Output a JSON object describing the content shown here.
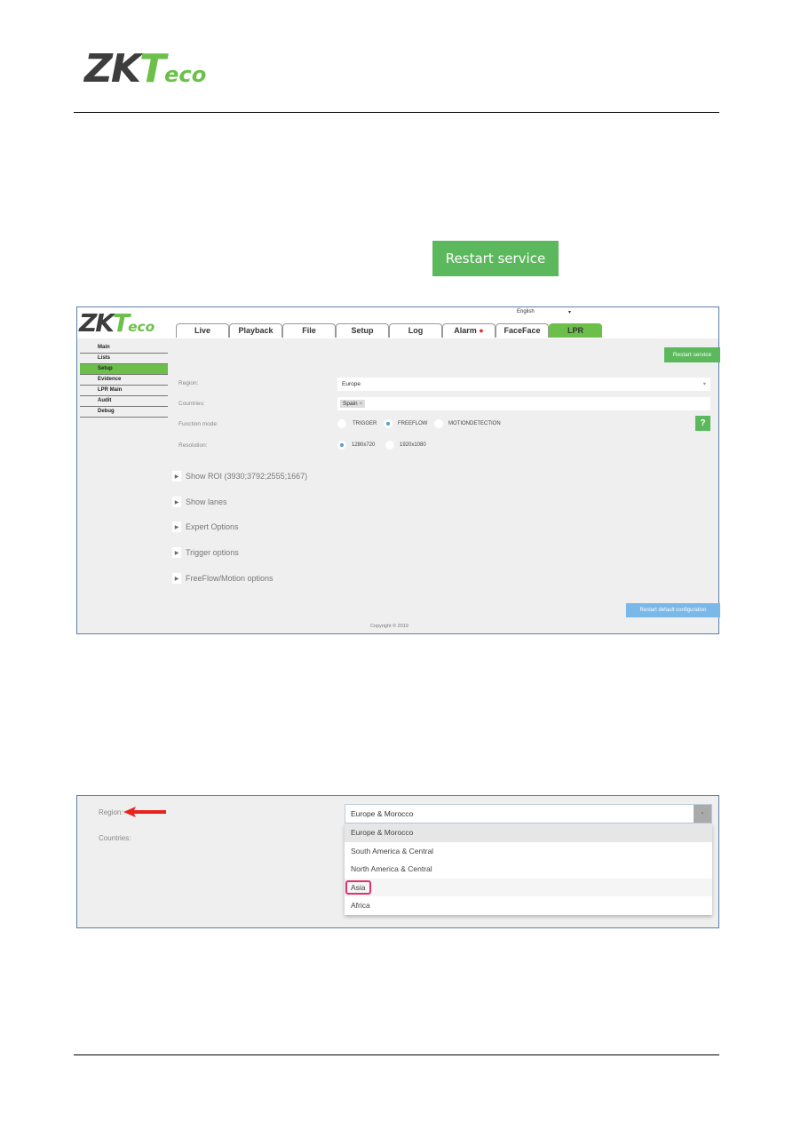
{
  "header": {
    "logo": {
      "zk": "ZK",
      "t": "T",
      "eco": "eco"
    }
  },
  "restart_service_big": "Restart service",
  "app": {
    "language": "English",
    "tabs": [
      {
        "label": "Live"
      },
      {
        "label": "Playback"
      },
      {
        "label": "File"
      },
      {
        "label": "Setup"
      },
      {
        "label": "Log"
      },
      {
        "label": "Alarm"
      },
      {
        "label": "FaceFace"
      },
      {
        "label": "LPR",
        "active": true
      }
    ],
    "sidebar": [
      {
        "label": "Main"
      },
      {
        "label": "Lists"
      },
      {
        "label": "Setup",
        "active": true
      },
      {
        "label": "Evidence"
      },
      {
        "label": "LPR Main"
      },
      {
        "label": "Audit"
      },
      {
        "label": "Debug"
      }
    ],
    "restart_service": "Restart service",
    "region_label": "Region:",
    "region_value": "Europe",
    "countries_label": "Countries:",
    "country_tag": "Spain",
    "function_mode_label": "Function mode:",
    "function_modes": [
      "TRIGGER",
      "FREEFLOW",
      "MOTIONDETECTION"
    ],
    "function_mode_selected": "FREEFLOW",
    "help": "?",
    "resolution_label": "Resolution:",
    "resolutions": [
      "1280x720",
      "1920x1080"
    ],
    "resolution_selected": "1280x720",
    "sections": [
      "Show ROI (3930;3792;2555;1667)",
      "Show lanes",
      "Expert Options",
      "Trigger options",
      "FreeFlow/Motion options"
    ],
    "restart_default": "Restart default configuration",
    "copyright": "Copyright © 2019"
  },
  "dropdown_shot": {
    "region_label": "Region:",
    "countries_label": "Countries:",
    "selected": "Europe & Morocco",
    "options": [
      "Europe & Morocco",
      "South America & Central",
      "North America & Central",
      "Asia",
      "Africa"
    ],
    "highlighted": "Asia"
  },
  "colors": {
    "green": "#5cb85c",
    "accent_green": "#6cc04a",
    "blue_button": "#7ab8e8",
    "highlight": "#e0336b"
  }
}
